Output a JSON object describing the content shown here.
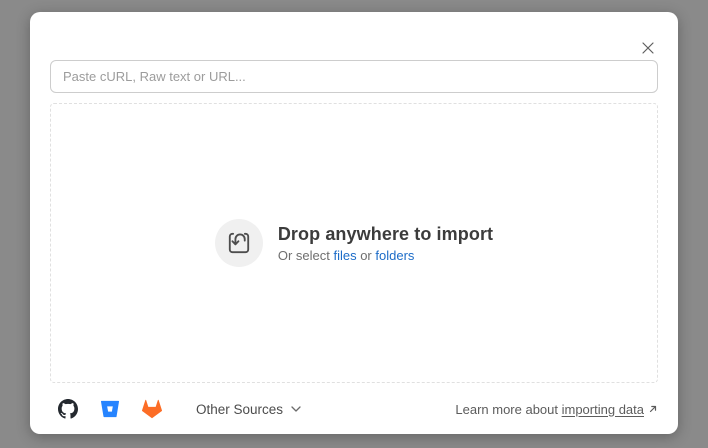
{
  "dialog": {
    "close_label": "Close"
  },
  "import_input": {
    "placeholder": "Paste cURL, Raw text or URL...",
    "value": ""
  },
  "dropzone": {
    "title": "Drop anywhere to import",
    "subtitle_prefix": "Or select ",
    "files_link_label": "files",
    "subtitle_conjunction": " or ",
    "folders_link_label": "folders"
  },
  "footer": {
    "source_icons": [
      "github-icon",
      "bitbucket-icon",
      "gitlab-icon"
    ],
    "other_sources_label": "Other Sources",
    "learn_more_prefix": "Learn more about ",
    "learn_more_link_label": "importing data"
  },
  "icons": {
    "close": "×",
    "chevron_down": "⌄",
    "external_link": "↗",
    "import_tray": "tray-arrow-down"
  },
  "colors": {
    "overlay": "#8a8a8a",
    "modal_background": "#ffffff",
    "link_blue": "#1c6cc8",
    "title_text": "#3c3c3c",
    "muted_text": "#6f6f6f",
    "dashed_border": "#e0e0e0",
    "github_black": "#24292f",
    "bitbucket_blue": "#2684ff",
    "gitlab_orange": "#fc6d26"
  }
}
